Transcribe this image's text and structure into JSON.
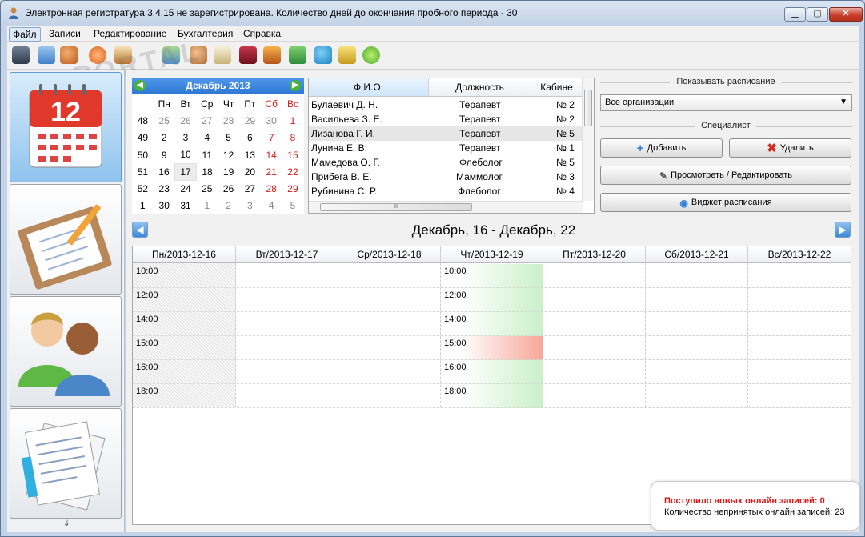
{
  "window": {
    "title": "Электронная регистратура 3.4.15 не зарегистрирована. Количество дней до окончания пробного периода - 30",
    "minimize": "▁",
    "maximize": "▢",
    "close": "✕"
  },
  "menu": [
    "Файл",
    "Записи",
    "Редактирование",
    "Бухгалтерия",
    "Справка"
  ],
  "watermark": "PORTAL",
  "calendar": {
    "title": "Декабрь  2013",
    "prev": "◀",
    "next": "▶",
    "weekdays": [
      "Пн",
      "Вт",
      "Ср",
      "Чт",
      "Пт",
      "Сб",
      "Вс"
    ],
    "weeks": [
      {
        "num": "48",
        "days": [
          "25",
          "26",
          "27",
          "28",
          "29",
          "30",
          "1"
        ]
      },
      {
        "num": "49",
        "days": [
          "2",
          "3",
          "4",
          "5",
          "6",
          "7",
          "8"
        ]
      },
      {
        "num": "50",
        "days": [
          "9",
          "10",
          "11",
          "12",
          "13",
          "14",
          "15"
        ]
      },
      {
        "num": "51",
        "days": [
          "16",
          "17",
          "18",
          "19",
          "20",
          "21",
          "22"
        ]
      },
      {
        "num": "52",
        "days": [
          "23",
          "24",
          "25",
          "26",
          "27",
          "28",
          "29"
        ]
      },
      {
        "num": "1",
        "days": [
          "30",
          "31",
          "1",
          "2",
          "3",
          "4",
          "5"
        ]
      }
    ],
    "colors": {
      "weekend": "#d21c1c",
      "muted": "#888888",
      "header": "#2f79d6"
    }
  },
  "specialists": {
    "columns": [
      "Ф.И.О.",
      "Должность",
      "Кабине"
    ],
    "rows": [
      [
        "Булаевич Д. Н.",
        "Терапевт",
        "№ 2"
      ],
      [
        "Васильева З. Е.",
        "Терапевт",
        "№ 2"
      ],
      [
        "Лизанова Г. И.",
        "Терапевт",
        "№ 5"
      ],
      [
        "Лунина Е. В.",
        "Терапевт",
        "№ 1"
      ],
      [
        "Мамедова О. Г.",
        "Флеболог",
        "№ 5"
      ],
      [
        "Прибега В. Е.",
        "Маммолог",
        "№ 3"
      ],
      [
        "Рубинина С. Р.",
        "Флеболог",
        "№ 4"
      ]
    ],
    "hscroll_grip": "III"
  },
  "panel": {
    "schedule_label": "Показывать расписание",
    "org_select": "Все организации",
    "specialist_label": "Специалист",
    "add": "Добавить",
    "delete": "Удалить",
    "view_edit": "Просмотреть / Редактировать",
    "widget": "Виджет расписания"
  },
  "week": {
    "title": "Декабрь, 16 - Декабрь, 22",
    "prev": "◀",
    "next": "▶",
    "days": [
      "Пн/2013-12-16",
      "Вт/2013-12-17",
      "Ср/2013-12-18",
      "Чт/2013-12-19",
      "Пт/2013-12-20",
      "Сб/2013-12-21",
      "Вс/2013-12-22"
    ],
    "times_mon": [
      "10:00",
      "12:00",
      "14:00",
      "15:00",
      "16:00",
      "18:00"
    ],
    "times_thu": [
      "10:00",
      "12:00",
      "14:00",
      "15:00",
      "16:00",
      "18:00"
    ],
    "colors": {
      "free": "#c9f0c9",
      "busy": "#f5a898"
    }
  },
  "notify": {
    "new": "Поступило новых онлайн записей: 0",
    "pending": "Количество непринятых онлайн записей: 23"
  }
}
